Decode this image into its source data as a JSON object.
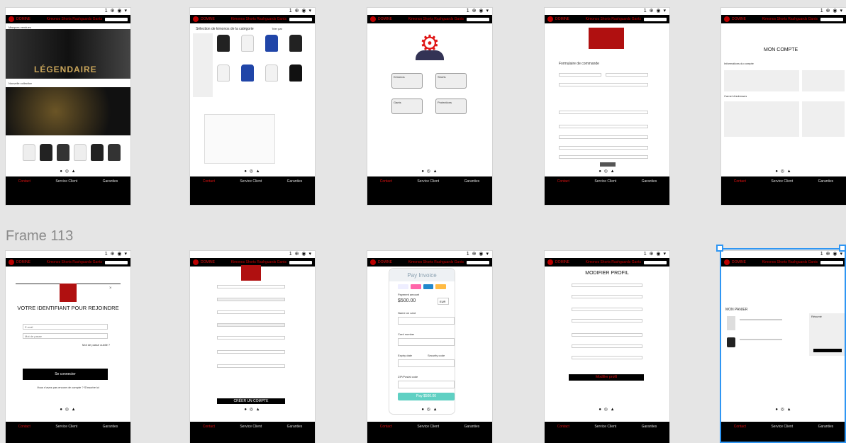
{
  "brand": "DOMINE",
  "nav": "Kimonos   Shorts   Rashguards   Gants",
  "footer": [
    "Contact",
    "Service Client",
    "Garanties"
  ],
  "frame_label": "Frame 113",
  "sys_icons": "1 ⊕ ◉ ▾",
  "social": "● ◎ ▲",
  "screens": {
    "home": {
      "caption1": "Marques vendues",
      "banner": "LÉGENDAIRE",
      "caption2": "Nouvelle collection"
    },
    "catalog": {
      "title": "Sélection de kimonos de la catégorie",
      "sort": "Trier par"
    },
    "menu": {
      "btn1": "Kimonos",
      "btn2": "Shorts",
      "btn3": "Gants",
      "btn4": "Protections"
    },
    "order": {
      "title": "Formulaire de commande"
    },
    "account": {
      "title": "MON COMPTE",
      "sec1": "Informations du compte",
      "sec2": "Carnet d'adresses"
    },
    "login": {
      "title": "VOTRE IDENTIFIANT POUR REJOINDRE",
      "email_ph": "E-mail",
      "pass_ph": "Mot de passe",
      "forgot": "Mot de passe oublié ?",
      "button": "Se connecter",
      "signup": "Vous n'avez pas encore de compte ? S'inscrire ici"
    },
    "register": {
      "button": "CRÉER UN COMPTE"
    },
    "invoice": {
      "title": "Pay Invoice",
      "amount_label": "Payment amount",
      "amount": "$500.00",
      "currency": "EUR",
      "name_label": "Name on card",
      "card_label": "Card number",
      "expiry_label": "Expiry date",
      "security_label": "Security code",
      "zip_label": "ZIP/Postal code",
      "pay_button": "Pay $500.00"
    },
    "profile": {
      "title": "MODIFIER PROFIL",
      "button": "Modifier profil"
    },
    "cart": {
      "title": "MON PANIER",
      "summary": "Résumé"
    }
  }
}
